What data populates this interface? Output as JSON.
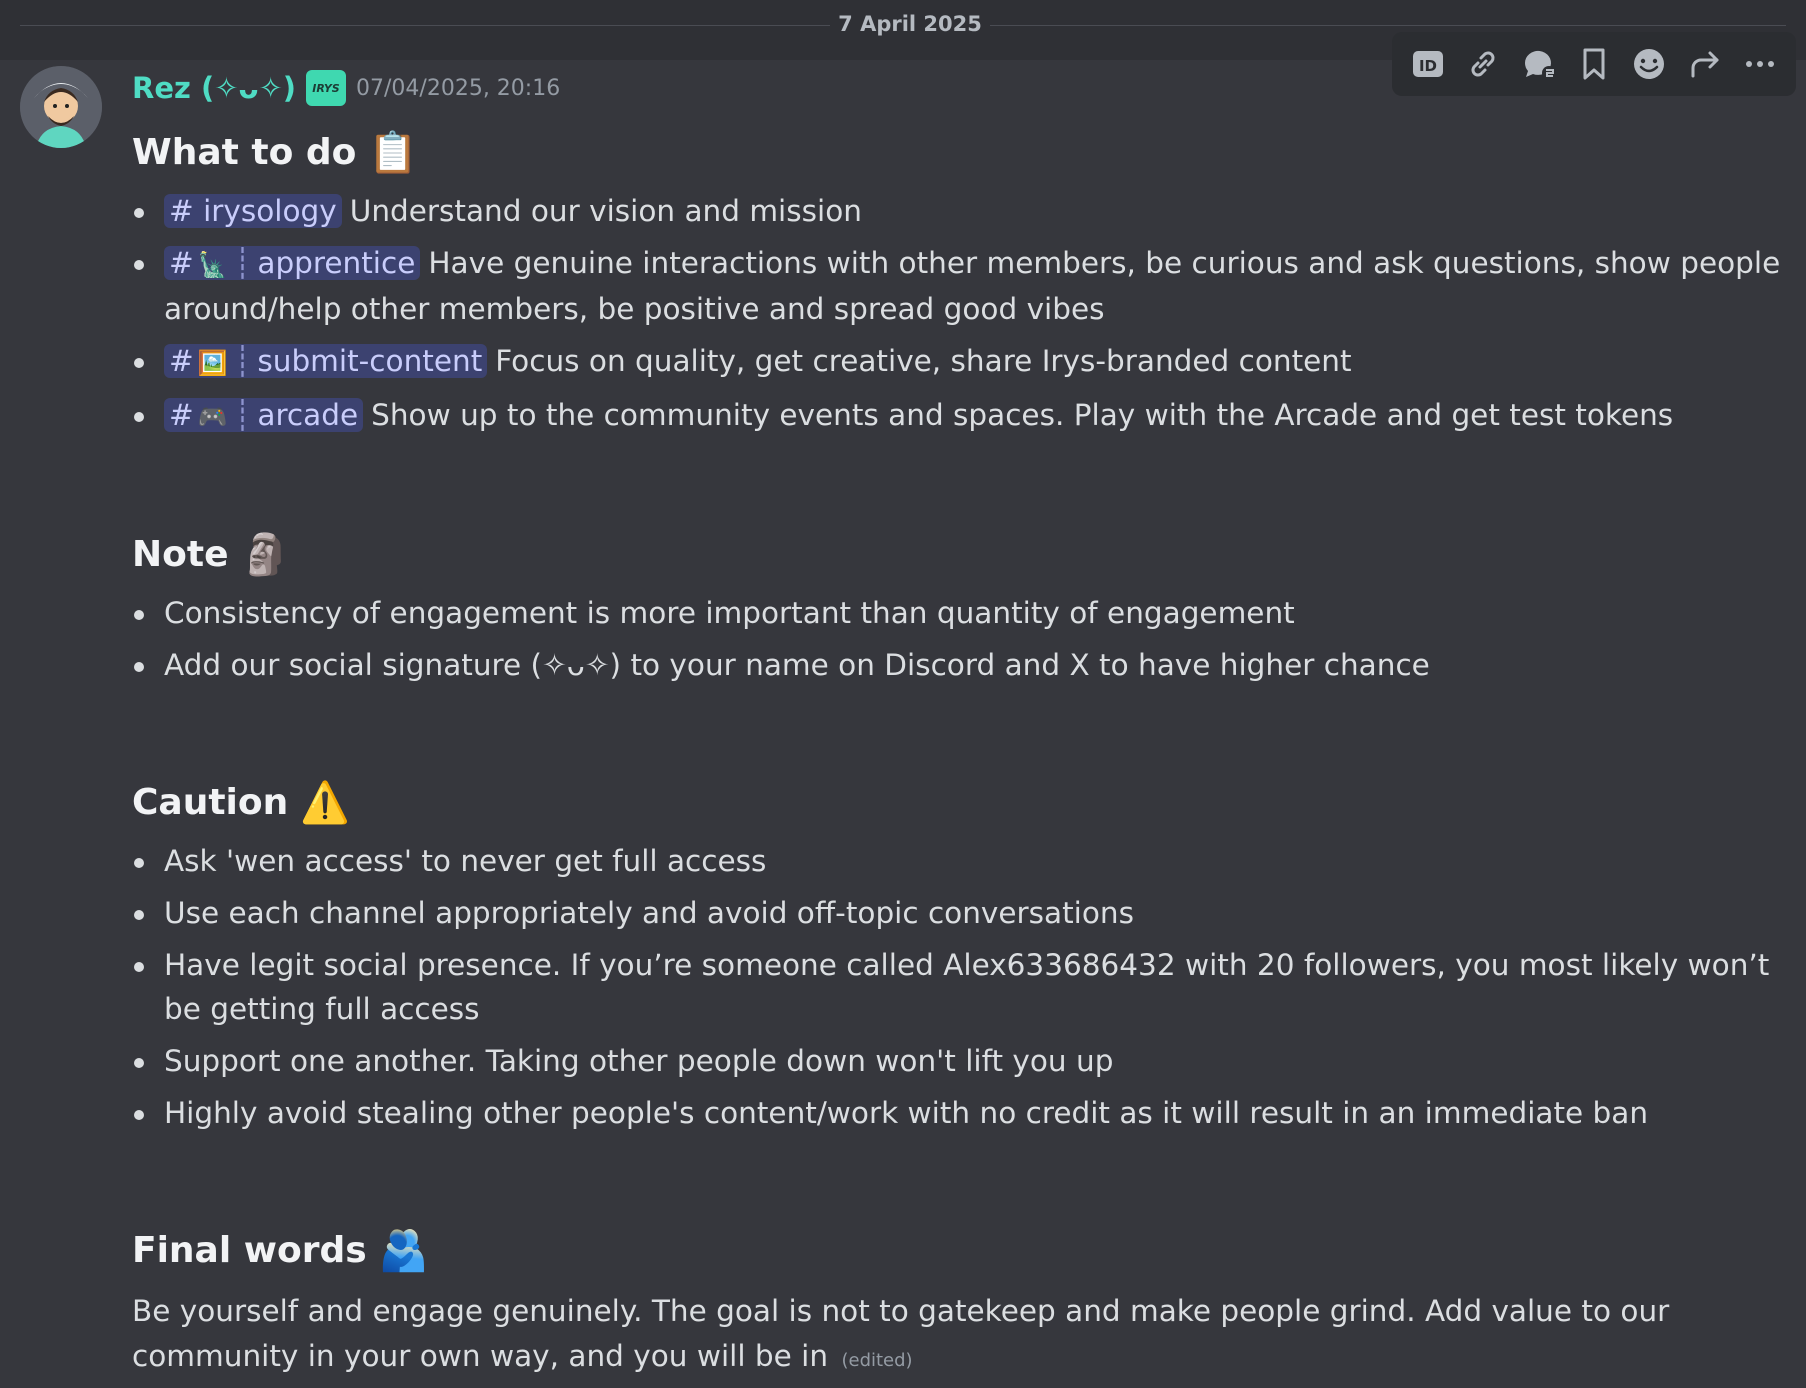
{
  "date_divider": "7 April 2025",
  "message": {
    "author": "Rez (✧ᴗ✧)",
    "tag": "IRYS",
    "timestamp": "07/04/2025, 20:16",
    "edited": "(edited)"
  },
  "toolbar": [
    "id-icon",
    "link-icon",
    "thread-reply-icon",
    "bookmark-icon",
    "reaction-icon",
    "forward-icon",
    "more-icon"
  ],
  "sections": {
    "todo": {
      "title": "What to do",
      "emoji": "📋",
      "items": [
        {
          "channel": "irysology",
          "channel_emoji": "",
          "text": "Understand our vision and mission"
        },
        {
          "channel": "apprentice",
          "channel_emoji": "🗽",
          "text": "Have genuine interactions with other members, be curious and ask questions, show people around/help other members, be positive and spread good vibes"
        },
        {
          "channel": "submit-content",
          "channel_emoji": "🖼️",
          "text": "Focus on quality, get creative, share Irys-branded content"
        },
        {
          "channel": "arcade",
          "channel_emoji": "🎮",
          "text": "Show up to the community events and spaces. Play with the Arcade and get test tokens"
        }
      ]
    },
    "note": {
      "title": "Note",
      "emoji": "🗿",
      "items": [
        "Consistency of engagement is more important than quantity of engagement",
        "Add our social signature (✧ᴗ✧) to your name on Discord and X to have higher chance"
      ]
    },
    "caution": {
      "title": "Caution",
      "emoji": "⚠️",
      "items": [
        "Ask 'wen access' to never get full access",
        "Use each channel appropriately and avoid off-topic conversations",
        "Have legit social presence. If you’re someone called Alex633686432 with 20 followers, you most likely won’t be getting full access",
        "Support one another. Taking other people down won't lift you up",
        "Highly avoid stealing other people's content/work with no credit as it will result in an immediate ban"
      ]
    },
    "final": {
      "title": "Final words",
      "emoji": "🫂",
      "text": "Be yourself and engage genuinely. The goal is not to gatekeep and make people grind. Add value to our community in your own way, and you will be in"
    }
  },
  "colors": {
    "background": "#36373d",
    "mention_bg": "#3c4270",
    "username": "#4fdcc4"
  }
}
